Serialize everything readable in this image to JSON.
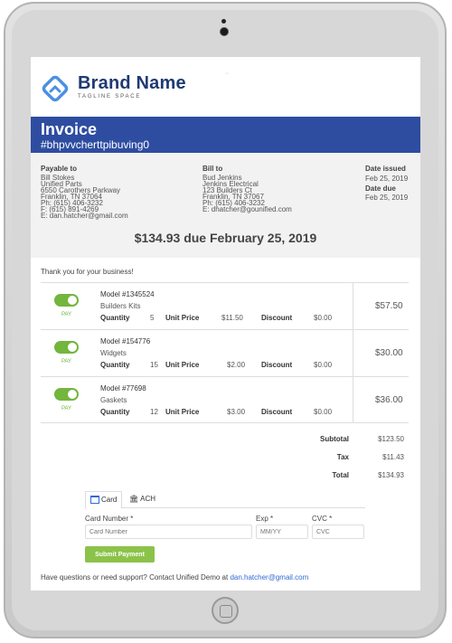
{
  "brand": {
    "name": "Brand Name",
    "tagline": "TAGLINE SPACE"
  },
  "invoice": {
    "title": "Invoice",
    "number": "#bhpvvcherttpibuving0"
  },
  "payable_to": {
    "label": "Payable to",
    "lines": [
      "Bill Stokes",
      "Unified Parts",
      "6550 Carothers Parkway",
      "Franklin, TN 37064",
      "Ph: (615) 406-3232",
      "F: (615) 891-4269",
      "E: dan.hatcher@gmail.com"
    ]
  },
  "bill_to": {
    "label": "Bill to",
    "lines": [
      "Bud Jenkins",
      "Jenkins Electrical",
      "123 Builders Ct",
      "Franklin, TN 37067",
      "Ph: (615) 406-3232",
      "E: dhatcher@gounified.com"
    ]
  },
  "dates": {
    "issued_label": "Date issued",
    "issued_value": "Feb 25, 2019",
    "due_label": "Date due",
    "due_value": "Feb 25, 2019"
  },
  "amount_due": "$134.93 due February 25, 2019",
  "thanks": "Thank you for your business!",
  "line_items": [
    {
      "pay_label": "PAY",
      "pay_on": true,
      "model": "Model #1345524",
      "item": "Builders Kits",
      "quantity_label": "Quantity",
      "quantity": "5",
      "unit_price_label": "Unit Price",
      "unit_price": "$11.50",
      "discount_label": "Discount",
      "discount": "$0.00",
      "amount": "$57.50"
    },
    {
      "pay_label": "PAY",
      "pay_on": true,
      "model": "Model #154776",
      "item": "Widgets",
      "quantity_label": "Quantity",
      "quantity": "15",
      "unit_price_label": "Unit Price",
      "unit_price": "$2.00",
      "discount_label": "Discount",
      "discount": "$0.00",
      "amount": "$30.00"
    },
    {
      "pay_label": "PAY",
      "pay_on": true,
      "model": "Model #77698",
      "item": "Gaskets",
      "quantity_label": "Quantity",
      "quantity": "12",
      "unit_price_label": "Unit Price",
      "unit_price": "$3.00",
      "discount_label": "Discount",
      "discount": "$0.00",
      "amount": "$36.00"
    }
  ],
  "totals": {
    "subtotal_label": "Subtotal",
    "subtotal": "$123.50",
    "tax_label": "Tax",
    "tax": "$11.43",
    "total_label": "Total",
    "total": "$134.93"
  },
  "payment": {
    "tabs": [
      {
        "label": "Card",
        "icon": "credit-card-icon"
      },
      {
        "label": "ACH",
        "icon": "bank-icon"
      }
    ],
    "active_tab": "Card",
    "card_number_label": "Card Number *",
    "card_number_placeholder": "Card Number",
    "exp_label": "Exp *",
    "exp_placeholder": "MM/YY",
    "cvc_label": "CVC *",
    "cvc_placeholder": "CVC",
    "submit_label": "Submit Payment"
  },
  "footer": {
    "text": "Have questions or need support? Contact Unified Demo at ",
    "email": "dan.hatcher@gmail.com"
  },
  "colors": {
    "banner": "#2e4da1",
    "brand_text": "#1f3a73",
    "toggle_on": "#73b53d",
    "submit_button": "#8bc34a",
    "link": "#2e6ad4"
  }
}
